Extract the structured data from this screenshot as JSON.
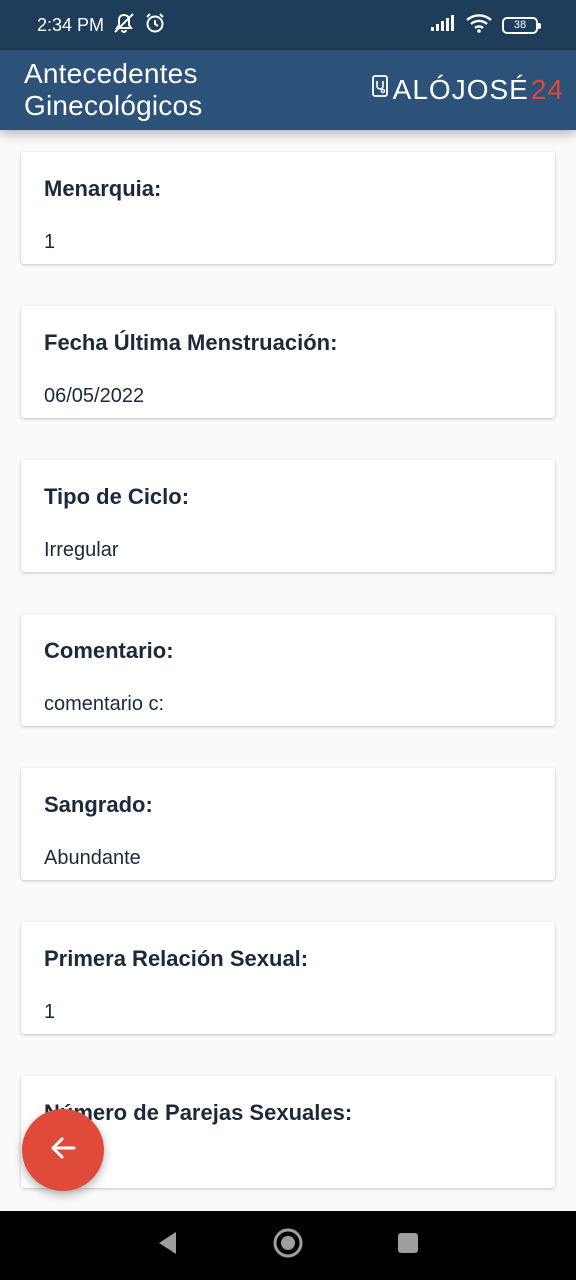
{
  "status_bar": {
    "time": "2:34 PM",
    "battery": "38",
    "icons": [
      "notifications-off-icon",
      "alarm-icon",
      "signal-icon",
      "wifi-icon",
      "battery-icon"
    ]
  },
  "app_bar": {
    "title": "Antecedentes Ginecológicos",
    "logo_text_a": "ALÓJOSÉ",
    "logo_text_b": "24"
  },
  "fields": [
    {
      "label": "Menarquia:",
      "value": "1"
    },
    {
      "label": "Fecha Última Menstruación:",
      "value": "06/05/2022"
    },
    {
      "label": "Tipo de Ciclo:",
      "value": "Irregular"
    },
    {
      "label": "Comentario:",
      "value": "comentario c:"
    },
    {
      "label": "Sangrado:",
      "value": "Abundante"
    },
    {
      "label": "Primera Relación Sexual:",
      "value": "1"
    },
    {
      "label": "Número de Parejas Sexuales:",
      "value": ""
    }
  ],
  "fab": {
    "icon": "arrow-back-icon"
  },
  "nav": {
    "icons": [
      "back-triangle-icon",
      "home-circle-icon",
      "recents-square-icon"
    ]
  },
  "colors": {
    "status_bar": "#1e3d5a",
    "app_bar": "#2c527a",
    "fab": "#e04a3a",
    "logo_accent": "#e0463a",
    "background": "#fafafa"
  }
}
